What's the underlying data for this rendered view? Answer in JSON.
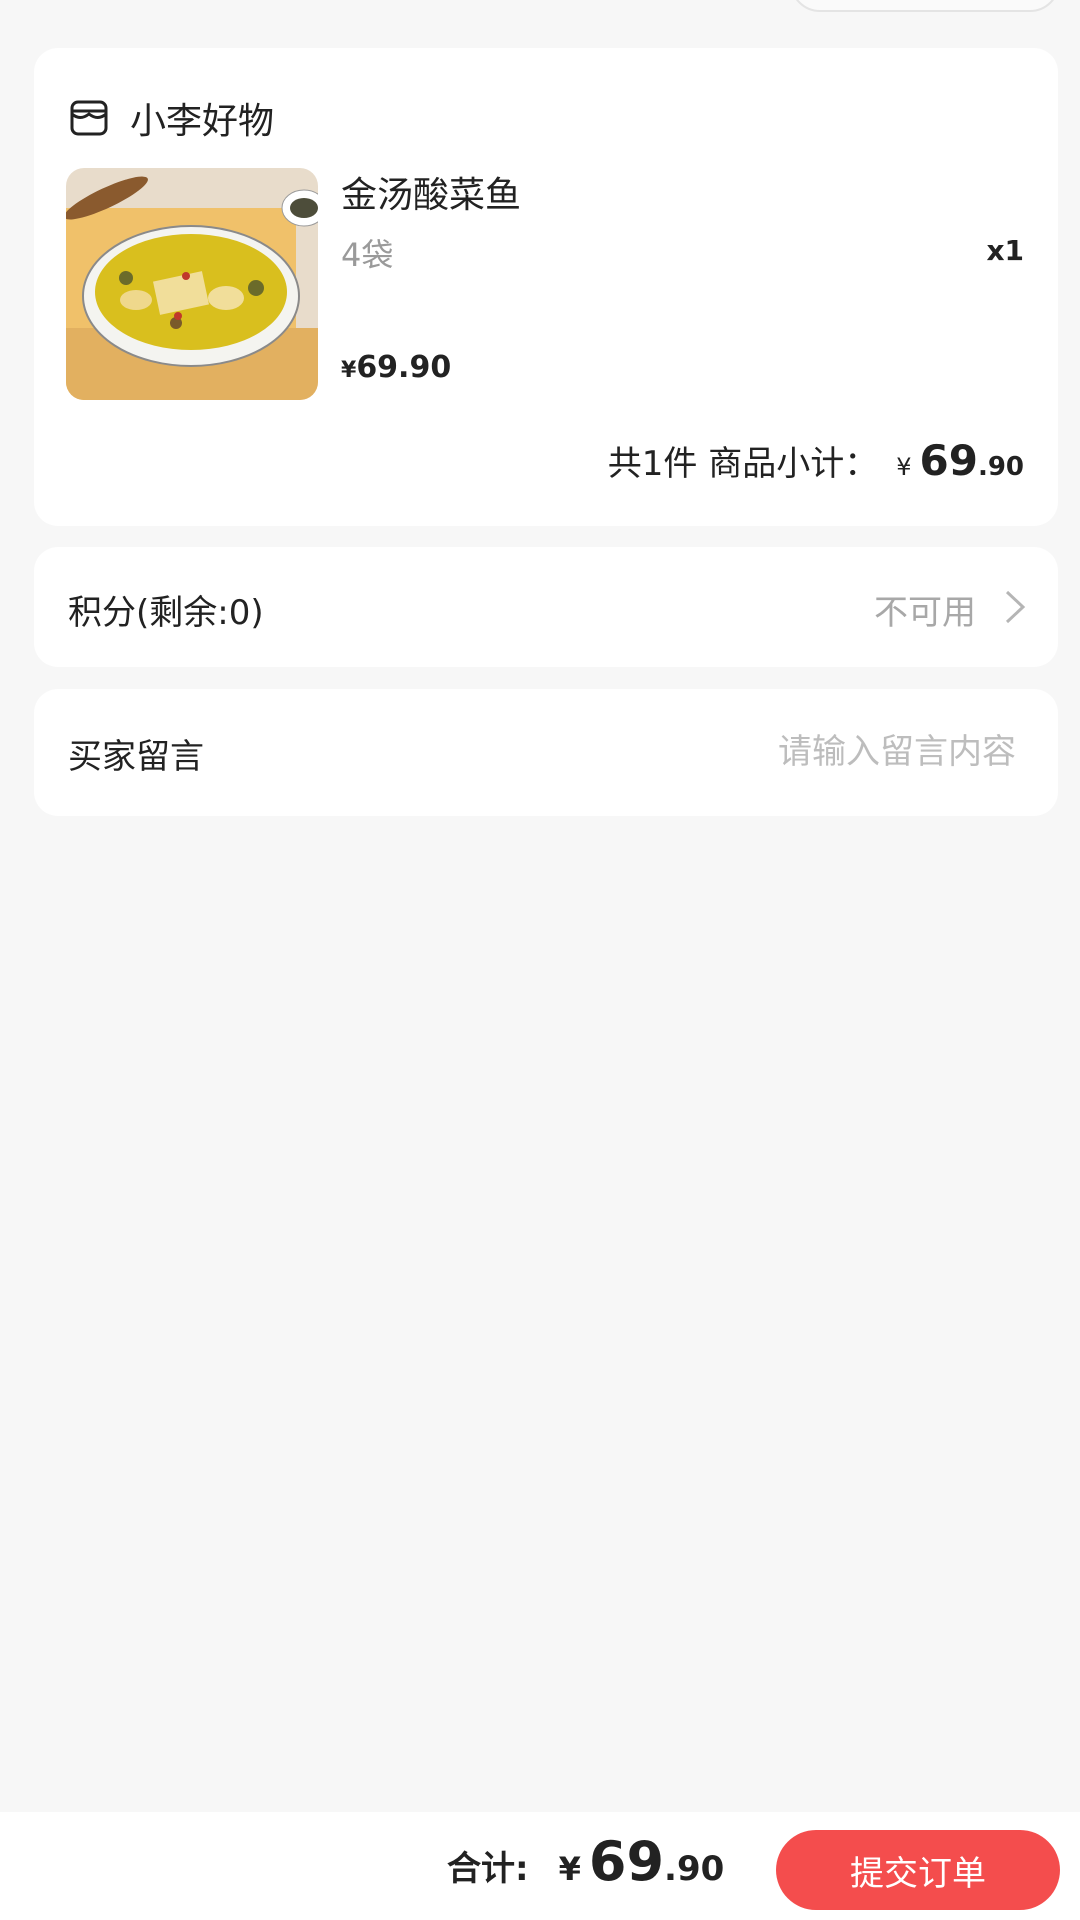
{
  "shop": {
    "name": "小李好物",
    "icon": "shop-icon",
    "product": {
      "title": "金汤酸菜鱼",
      "spec": "4袋",
      "quantity": "x1",
      "price_symbol": "¥",
      "price": "69.90"
    },
    "subtotal": {
      "label": "共1件 商品小计：",
      "symbol": "¥",
      "integer": "69",
      "decimal": ".90"
    }
  },
  "points": {
    "label": "积分(剩余:0)",
    "status": "不可用",
    "icon": "chevron-right-icon"
  },
  "message": {
    "label": "买家留言",
    "placeholder": "请输入留言内容",
    "value": ""
  },
  "footer": {
    "total_label": "合计:",
    "total_symbol": "¥",
    "total_integer": "69",
    "total_decimal": ".90",
    "submit_label": "提交订单"
  },
  "colors": {
    "accent": "#f44d4d",
    "background": "#f7f7f7",
    "muted_text": "#9a9a9a"
  }
}
